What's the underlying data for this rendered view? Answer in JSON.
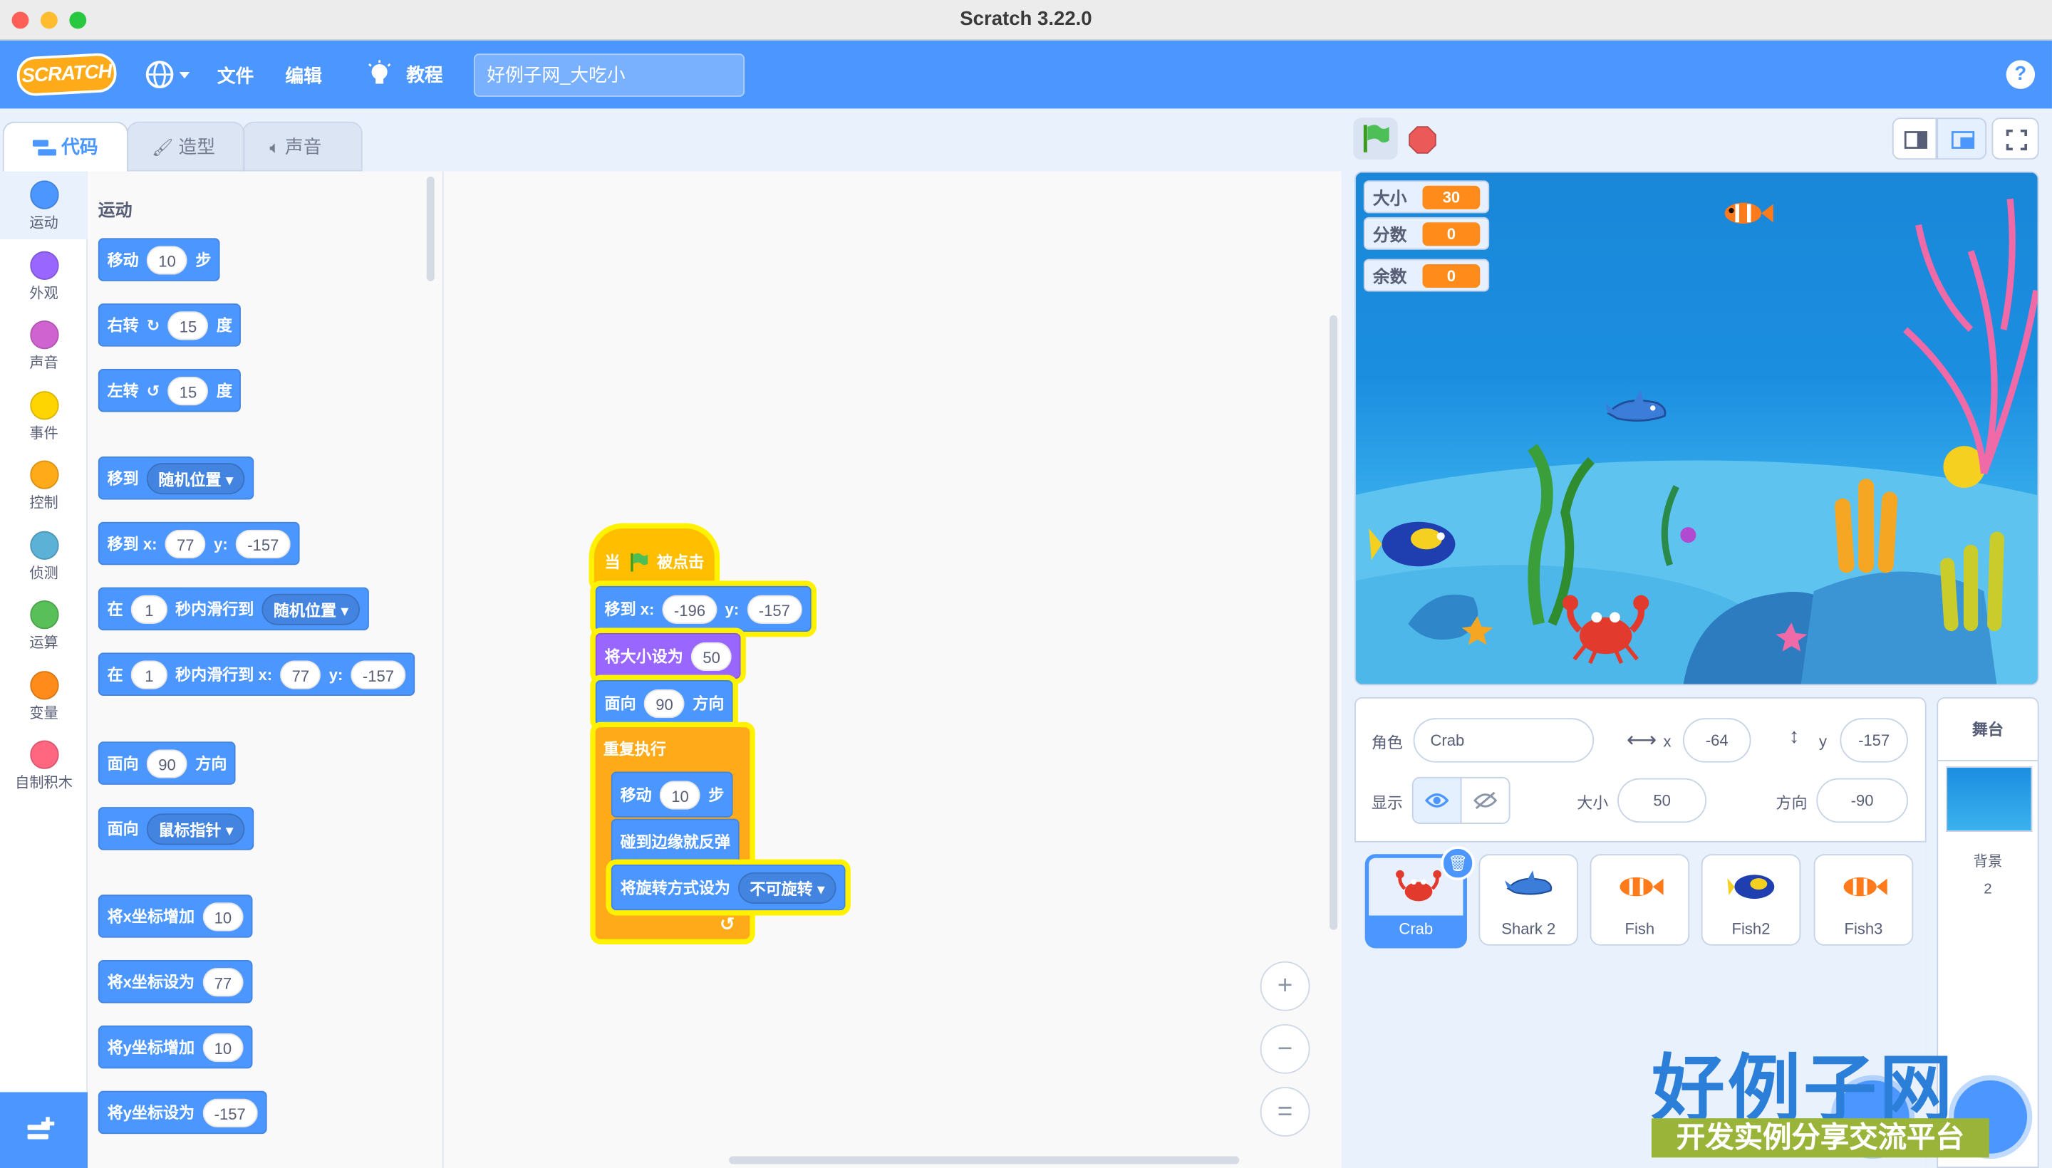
{
  "window": {
    "title": "Scratch 3.22.0"
  },
  "menubar": {
    "logo": "SCRATCH",
    "file": "文件",
    "edit": "编辑",
    "tutorials": "教程",
    "project_title": "好例子网_大吃小"
  },
  "tabs": {
    "code": "代码",
    "costumes": "造型",
    "sounds": "声音"
  },
  "categories": [
    {
      "label": "运动",
      "color": "#4c97ff"
    },
    {
      "label": "外观",
      "color": "#9966ff"
    },
    {
      "label": "声音",
      "color": "#cf63cf"
    },
    {
      "label": "事件",
      "color": "#ffd500"
    },
    {
      "label": "控制",
      "color": "#ffab19"
    },
    {
      "label": "侦测",
      "color": "#5cb1d6"
    },
    {
      "label": "运算",
      "color": "#59c059"
    },
    {
      "label": "变量",
      "color": "#ff8c1a"
    },
    {
      "label": "自制积木",
      "color": "#ff6680"
    }
  ],
  "palette": {
    "section": "运动",
    "move": {
      "a": "移动",
      "v": "10",
      "b": "步"
    },
    "turn_right": {
      "a": "右转",
      "v": "15",
      "b": "度"
    },
    "turn_left": {
      "a": "左转",
      "v": "15",
      "b": "度"
    },
    "goto": {
      "a": "移到",
      "dd": "随机位置"
    },
    "goto_xy": {
      "a": "移到 x:",
      "x": "77",
      "y_label": "y:",
      "y": "-157"
    },
    "glide": {
      "a": "在",
      "v": "1",
      "b": "秒内滑行到",
      "dd": "随机位置"
    },
    "glide_xy": {
      "a": "在",
      "v": "1",
      "b": "秒内滑行到 x:",
      "x": "77",
      "y_label": "y:",
      "y": "-157"
    },
    "point_dir": {
      "a": "面向",
      "v": "90",
      "b": "方向"
    },
    "point_towards": {
      "a": "面向",
      "dd": "鼠标指针"
    },
    "change_x": {
      "a": "将x坐标增加",
      "v": "10"
    },
    "set_x": {
      "a": "将x坐标设为",
      "v": "77"
    },
    "change_y": {
      "a": "将y坐标增加",
      "v": "10"
    },
    "set_y": {
      "a": "将y坐标设为",
      "v": "-157"
    }
  },
  "script": {
    "hat": {
      "a": "当",
      "b": "被点击"
    },
    "goto_xy": {
      "a": "移到 x:",
      "x": "-196",
      "y_label": "y:",
      "y": "-157"
    },
    "set_size": {
      "a": "将大小设为",
      "v": "50"
    },
    "point_dir": {
      "a": "面向",
      "v": "90",
      "b": "方向"
    },
    "forever": "重复执行",
    "move": {
      "a": "移动",
      "v": "10",
      "b": "步"
    },
    "bounce": "碰到边缘就反弹",
    "rotation": {
      "a": "将旋转方式设为",
      "dd": "不可旋转"
    }
  },
  "zoom": {
    "in": "+",
    "out": "−",
    "reset": "="
  },
  "monitors": [
    {
      "label": "大小",
      "value": "30"
    },
    {
      "label": "分数",
      "value": "0"
    },
    {
      "label": "余数",
      "value": "0"
    }
  ],
  "sprite_info": {
    "sprite_label": "角色",
    "sprite_name": "Crab",
    "x_label": "x",
    "x": "-64",
    "y_label": "y",
    "y": "-157",
    "show_label": "显示",
    "size_label": "大小",
    "size": "50",
    "direction_label": "方向",
    "direction": "-90"
  },
  "sprites": [
    "Crab",
    "Shark 2",
    "Fish",
    "Fish2",
    "Fish3"
  ],
  "stage_pane": {
    "title": "舞台",
    "backdrop_label": "背景",
    "backdrop_count": "2"
  },
  "watermark": {
    "main": "好例子网",
    "sub": "开发实例分享交流平台"
  }
}
